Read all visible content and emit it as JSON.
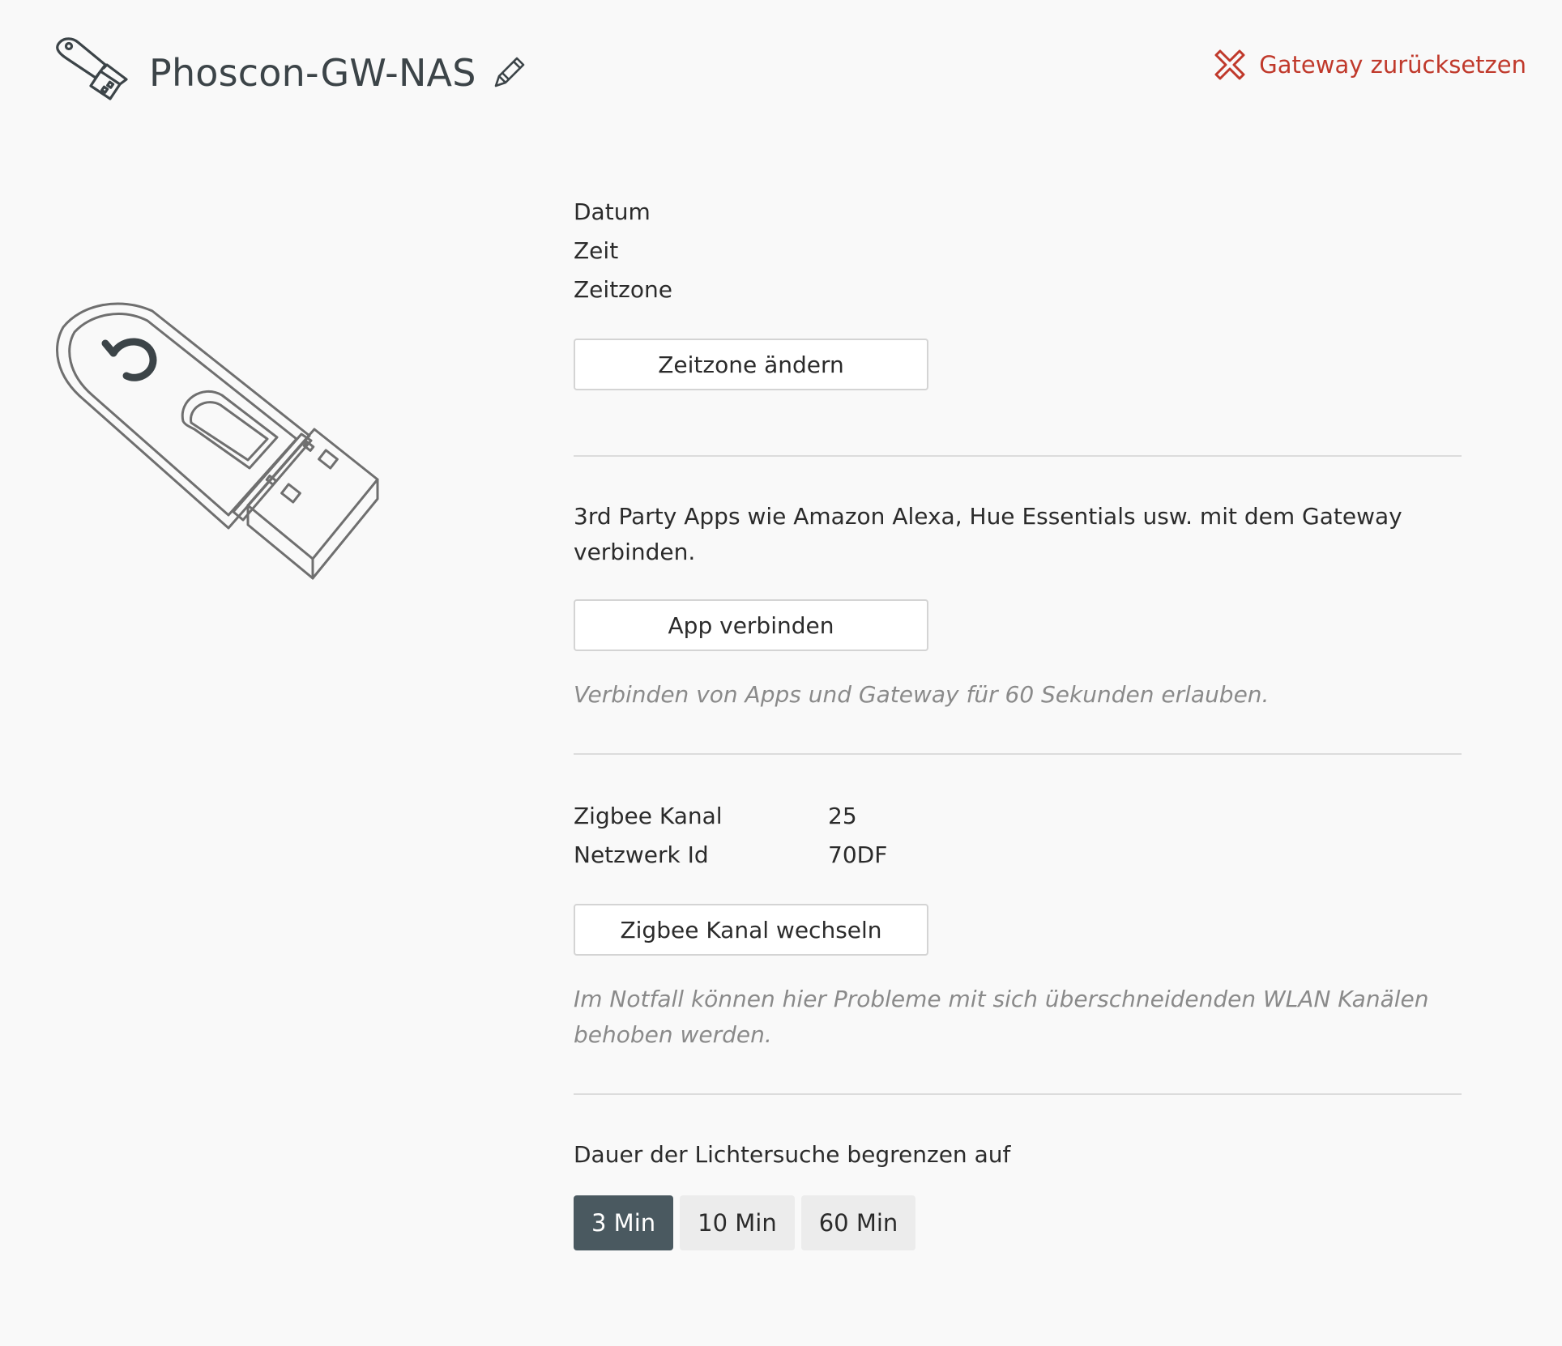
{
  "header": {
    "title": "Phoscon-GW-NAS",
    "device_icon": "usb-stick-icon",
    "edit_icon": "pencil-icon",
    "reset_label": "Gateway zurücksetzen",
    "reset_icon": "close-x-icon"
  },
  "colors": {
    "background": "#f9f9f9",
    "danger": "#c0392b",
    "active_segment": "#4a5960",
    "inactive_segment": "#ececec",
    "hint_text": "#8a8a8a"
  },
  "time_section": {
    "date_label": "Datum",
    "time_label": "Zeit",
    "timezone_label": "Zeitzone",
    "change_timezone_button": "Zeitzone ändern"
  },
  "apps_section": {
    "description": "3rd Party Apps wie Amazon Alexa, Hue Essentials usw. mit dem Gateway verbinden.",
    "connect_button": "App verbinden",
    "hint": "Verbinden von Apps und Gateway für 60 Sekunden erlauben."
  },
  "zigbee_section": {
    "channel_label": "Zigbee Kanal",
    "channel_value": "25",
    "network_id_label": "Netzwerk Id",
    "network_id_value": "70DF",
    "change_channel_button": "Zigbee Kanal wechseln",
    "hint": "Im Notfall können hier Probleme mit sich überschneidenden WLAN Kanälen behoben werden."
  },
  "search_duration": {
    "label": "Dauer der Lichtersuche begrenzen auf",
    "options": [
      "3 Min",
      "10 Min",
      "60 Min"
    ],
    "selected": "3 Min"
  }
}
